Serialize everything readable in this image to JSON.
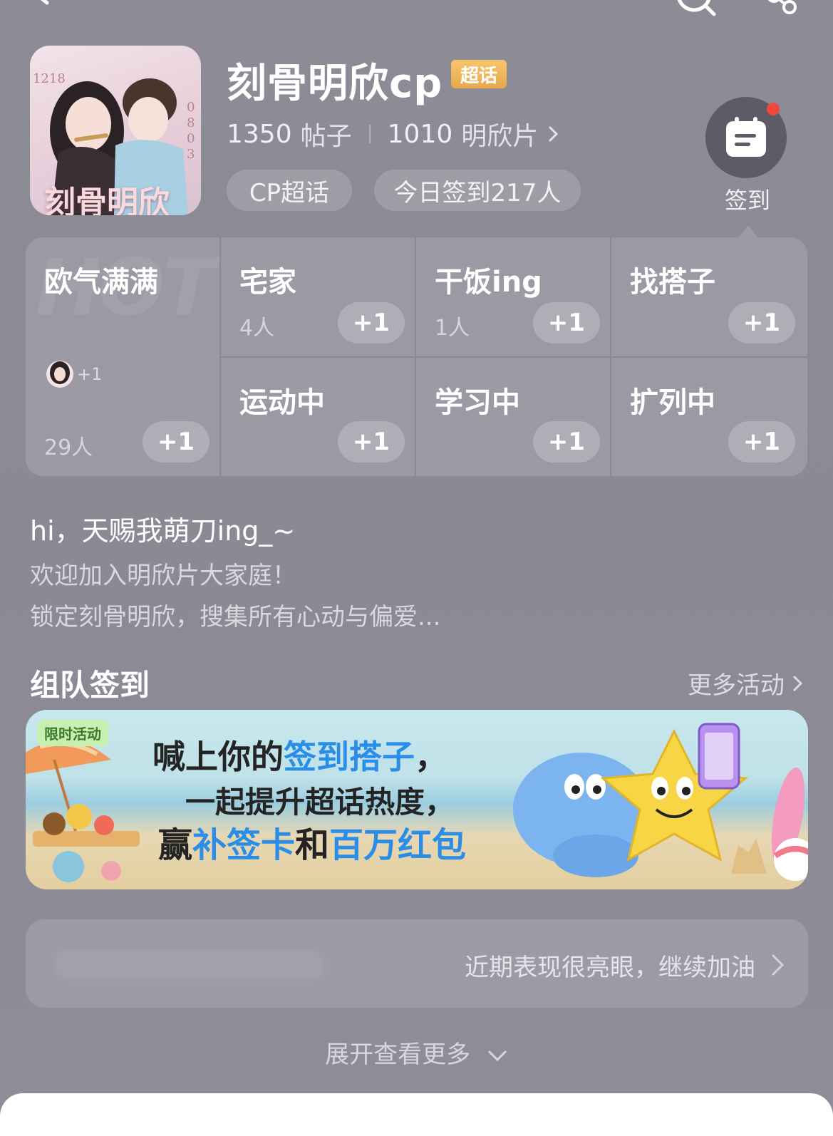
{
  "topbar": {
    "back_icon": "back-arrow-icon",
    "search_icon": "search-icon",
    "share_icon": "share-icon"
  },
  "header": {
    "avatar_text": "刻骨明欣",
    "avatar_left_digits": "1218",
    "avatar_right_digits": "0803",
    "title": "刻骨明欣cp",
    "badge": "超话",
    "posts_count": "1350",
    "posts_label": "帖子",
    "fans_count": "1010",
    "fans_label": "明欣片",
    "chip_type": "CP超话",
    "chip_checkin": "今日签到217人",
    "sign_label": "签到"
  },
  "moods": [
    {
      "title": "欧气满满",
      "count": "29人",
      "avatar_plus": "+1",
      "button": "+1"
    },
    {
      "title": "宅家",
      "count": "4人",
      "button": "+1"
    },
    {
      "title": "干饭ing",
      "count": "1人",
      "button": "+1"
    },
    {
      "title": "找搭子",
      "count": "",
      "button": "+1"
    },
    {
      "title": "运动中",
      "count": "",
      "button": "+1"
    },
    {
      "title": "学习中",
      "count": "",
      "button": "+1"
    },
    {
      "title": "扩列中",
      "count": "",
      "button": "+1"
    }
  ],
  "intro": {
    "line1": "hi，天赐我萌刀ing_~",
    "line2": "欢迎加入明欣片大家庭！",
    "line3": "锁定刻骨明欣，搜集所有心动与偏爱..."
  },
  "team": {
    "title": "组队签到",
    "more": "更多活动",
    "banner_tag": "限时活动",
    "banner_line1_a": "喊上你的",
    "banner_line1_b": "签到搭子",
    "banner_line1_c": "，",
    "banner_line2": "一起提升超话热度，",
    "banner_line3_a": "赢",
    "banner_line3_b": "补签卡",
    "banner_line3_c": "和",
    "banner_line3_d": "百万红包"
  },
  "performance": {
    "text": "近期表现很亮眼，继续加油"
  },
  "expand": {
    "label": "展开查看更多"
  }
}
